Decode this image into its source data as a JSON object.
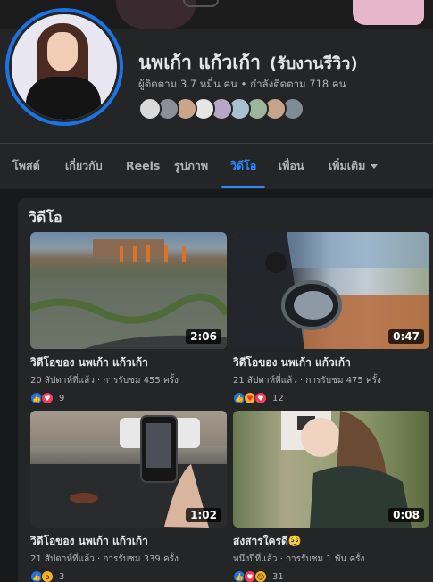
{
  "profile": {
    "name": "นพเก้า แก้วเก้า",
    "nickname": "(รับงานรีวิว)",
    "followers_text": "ผู้ติดตาม 3.7 หมื่น คน • กำลังติดตาม 718 คน",
    "friend_avatar_colors": [
      "#d9d9d9",
      "#8a8f98",
      "#c9a68a",
      "#e6e6e6",
      "#b7a7c6",
      "#a8c1d1",
      "#9db59a",
      "#c4a48a",
      "#7e8c96"
    ]
  },
  "tabs": [
    {
      "label": "โพสต์"
    },
    {
      "label": "เกี่ยวกับ"
    },
    {
      "label": "Reels"
    },
    {
      "label": "รูปภาพ"
    },
    {
      "label": "วิดีโอ"
    },
    {
      "label": "เพื่อน"
    },
    {
      "label": "เพิ่มเติม"
    }
  ],
  "active_tab": "วิดีโอ",
  "section_title": "วิดีโอ",
  "videos": [
    {
      "title": "วิดีโอของ นพเก้า แก้วเก้า",
      "meta": "20 สัปดาห์ที่แล้ว · การรับชม 455 ครั้ง",
      "duration": "2:06",
      "reaction_count": "9",
      "reactions": [
        "like",
        "love"
      ]
    },
    {
      "title": "วิดีโอของ นพเก้า แก้วเก้า",
      "meta": "21 สัปดาห์ที่แล้ว · การรับชม 475 ครั้ง",
      "duration": "0:47",
      "reaction_count": "12",
      "reactions": [
        "like",
        "care",
        "love"
      ]
    },
    {
      "title": "วิดีโอของ นพเก้า แก้วเก้า",
      "meta": "21 สัปดาห์ที่แล้ว · การรับชม 339 ครั้ง",
      "duration": "1:02",
      "reaction_count": "3",
      "reactions": [
        "like",
        "wow"
      ]
    },
    {
      "title": "สงสารใครดี🥺",
      "meta": "หนึ่งปีที่แล้ว · การรับชม 1 พัน ครั้ง",
      "duration": "0:08",
      "reaction_count": "31",
      "reactions": [
        "like",
        "love",
        "haha"
      ]
    }
  ],
  "colors": {
    "accent": "#2d88ff",
    "surface": "#242526",
    "background": "#18191a"
  }
}
